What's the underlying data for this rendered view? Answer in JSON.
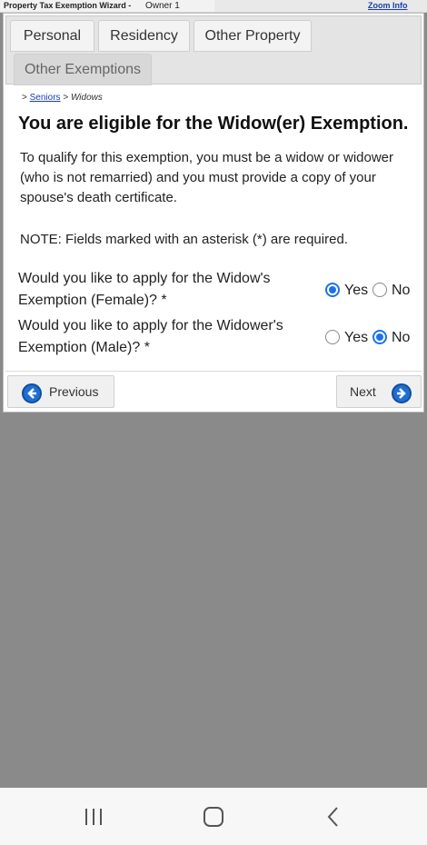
{
  "topbar": {
    "app_title": "Property Tax Exemption Wizard -",
    "owner": "Owner 1",
    "zoom_link": "Zoom Info"
  },
  "tabs": [
    {
      "label": "Personal",
      "active": false
    },
    {
      "label": "Residency",
      "active": false
    },
    {
      "label": "Other Property",
      "active": false
    },
    {
      "label": "Other Exemptions",
      "active": true
    }
  ],
  "breadcrumb": {
    "sep": ">",
    "link": "Seniors",
    "current": "Widows"
  },
  "heading": "You are eligible for the Widow(er) Exemption.",
  "description": "To qualify for this exemption, you must be a widow or widower (who is not remarried) and you must provide a copy of your spouse's death certificate.",
  "note": "NOTE: Fields marked with an asterisk (*) are required.",
  "questions": [
    {
      "text": "Would you like to apply for the Widow's Exemption (Female)? *",
      "yes": "Yes",
      "no": "No",
      "selected": "yes"
    },
    {
      "text": "Would you like to apply for the Widower's Exemption (Male)? *",
      "yes": "Yes",
      "no": "No",
      "selected": "no"
    }
  ],
  "nav": {
    "previous": "Previous",
    "next": "Next"
  },
  "colors": {
    "accent": "#1a73e8",
    "link": "#1a3fb0",
    "background": "#8a8a8a"
  },
  "icons": [
    "arrow-left-icon",
    "arrow-right-icon",
    "recent-apps-icon",
    "home-icon",
    "back-icon"
  ]
}
